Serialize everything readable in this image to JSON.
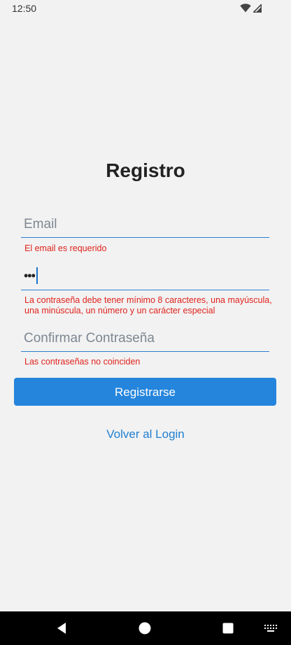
{
  "status_bar": {
    "time": "12:50",
    "icons": [
      "wifi-icon",
      "signal-icon"
    ]
  },
  "form": {
    "title": "Registro",
    "email": {
      "placeholder": "Email",
      "value": ""
    },
    "email_error": "El email es requerido",
    "password": {
      "value": "•••"
    },
    "password_error_line1": "La contraseña debe tener mínimo 8 caracteres, una mayúscula,",
    "password_error_line2": "una minúscula, un número y un carácter especial",
    "confirm_password": {
      "placeholder": "Confirmar Contraseña",
      "value": ""
    },
    "confirm_error": "Las contraseñas no coinciden",
    "submit_label": "Registrarse",
    "back_link": "Volver al Login"
  },
  "nav_bar": {
    "buttons": [
      "back-icon",
      "home-icon",
      "recents-icon",
      "keyboard-icon"
    ]
  },
  "colors": {
    "background": "#f2f2f2",
    "accent": "#2585dc",
    "error": "#e0221c",
    "link": "#1f7fd0"
  }
}
